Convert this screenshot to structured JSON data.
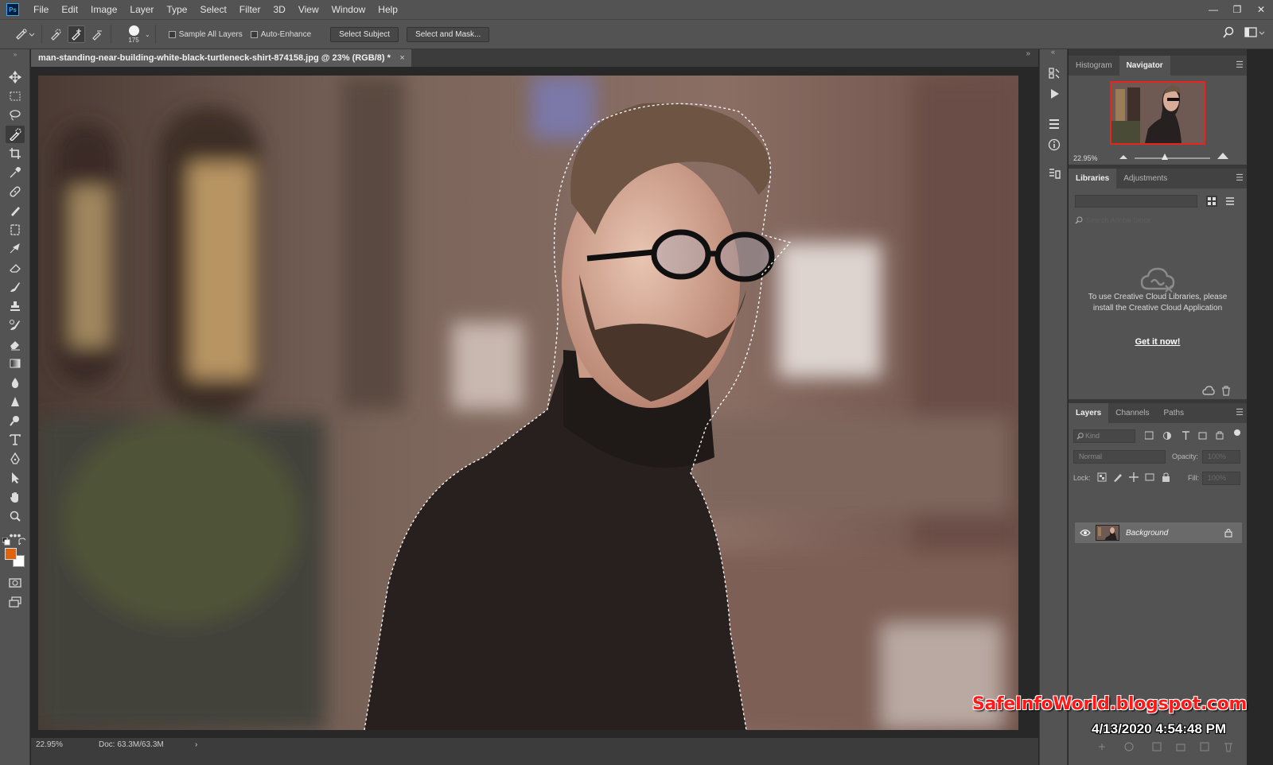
{
  "app": {
    "logo_text": "Ps"
  },
  "menu": [
    "File",
    "Edit",
    "Image",
    "Layer",
    "Type",
    "Select",
    "Filter",
    "3D",
    "View",
    "Window",
    "Help"
  ],
  "options": {
    "brush_size": "175",
    "sample_all_layers": "Sample All Layers",
    "auto_enhance": "Auto-Enhance",
    "select_subject": "Select Subject",
    "select_and_mask": "Select and Mask..."
  },
  "document": {
    "tab_title": "man-standing-near-building-white-black-turtleneck-shirt-874158.jpg @ 23% (RGB/8) *",
    "close_glyph": "×",
    "status_zoom": "22.95%",
    "doc_size": "Doc: 63.3M/63.3M",
    "status_arrow": "›"
  },
  "colors": {
    "foreground": "#e0630e",
    "background": "#ffffff",
    "accent": "#31a8ff"
  },
  "navigator_panel": {
    "tabs": [
      "Histogram",
      "Navigator"
    ],
    "active_tab": "Navigator",
    "zoom": "22.95%",
    "zoom_slider_position": 0.4
  },
  "libraries_panel": {
    "tabs": [
      "Libraries",
      "Adjustments"
    ],
    "active_tab": "Libraries",
    "search_placeholder": "Search Adobe Stock",
    "message": "To use Creative Cloud Libraries, please install the Creative Cloud Application",
    "link": "Get it now!"
  },
  "layers_panel": {
    "tabs": [
      "Layers",
      "Channels",
      "Paths"
    ],
    "active_tab": "Layers",
    "filter_kind": "Kind",
    "blend_mode": "Normal",
    "opacity_label": "Opacity:",
    "opacity_value": "100%",
    "lock_label": "Lock:",
    "fill_label": "Fill:",
    "fill_value": "100%",
    "layers": [
      {
        "name": "Background",
        "visible": true,
        "locked": true
      }
    ]
  },
  "watermark": {
    "site": "SafeInfoWorld.blogspot.com",
    "datetime": "4/13/2020  4:54:48 PM"
  }
}
